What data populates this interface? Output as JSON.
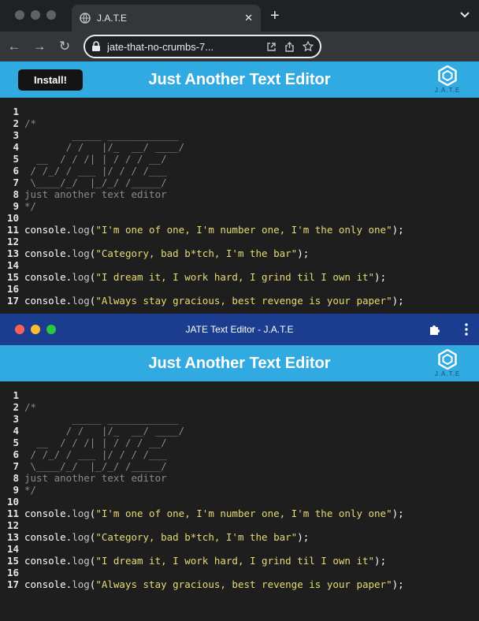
{
  "browser": {
    "tab_title": "J.A.T.E",
    "url": "jate-that-no-crumbs-7..."
  },
  "popup": {
    "window_title": "JATE Text Editor - J.A.T.E"
  },
  "app": {
    "title": "Just Another Text Editor",
    "install_label": "Install!",
    "logo_text": "J.A.T.E"
  },
  "editor": {
    "line_numbers": [
      "1",
      "2",
      "3",
      "4",
      "5",
      "6",
      "7",
      "8",
      "9",
      "10",
      "11",
      "12",
      "13",
      "14",
      "15",
      "16",
      "17"
    ],
    "comment_lines": [
      "/*",
      "        _____ ____________",
      "       / /   |/_  __/ ____/",
      "  __  / / /| | / / / __/",
      " / /_/ / ___ |/ / / /___",
      " \\____/_/  |_/_/ /_____/",
      "just another text editor",
      "*/"
    ],
    "code_lines": [
      {
        "obj": "console.",
        "fn": "log",
        "open": "(",
        "str": "\"I'm one of one, I'm number one, I'm the only one\"",
        "close": ");"
      },
      {
        "obj": "console.",
        "fn": "log",
        "open": "(",
        "str": "\"Category, bad b*tch, I'm the bar\"",
        "close": ");"
      },
      {
        "obj": "console.",
        "fn": "log",
        "open": "(",
        "str": "\"I dream it, I work hard, I grind til I own it\"",
        "close": ");"
      },
      {
        "obj": "console.",
        "fn": "log",
        "open": "(",
        "str": "\"Always stay gracious, best revenge is your paper\"",
        "close": ");"
      }
    ]
  },
  "colors": {
    "header": "#31a9e1",
    "editor_bg": "#1e1e1e",
    "string": "#e6db74",
    "comment": "#8a8a8a"
  }
}
